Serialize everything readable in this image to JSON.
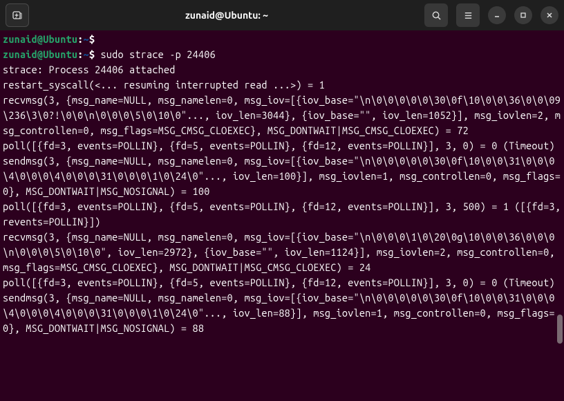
{
  "window": {
    "title": "zunaid@Ubuntu: ~"
  },
  "prompt": {
    "user_host": "zunaid@Ubuntu",
    "path": "~",
    "symbol": "$"
  },
  "commands": {
    "line1": "",
    "line2": "sudo strace -p 24406"
  },
  "output": [
    "strace: Process 24406 attached",
    "restart_syscall(<... resuming interrupted read ...>) = 1",
    "recvmsg(3, {msg_name=NULL, msg_namelen=0, msg_iov=[{iov_base=\"\\n\\0\\0\\0\\0\\0\\30\\0f\\10\\0\\0\\36\\0\\0\\09\\236\\3\\0?!\\0\\0\\n\\0\\0\\0\\5\\0\\10\\0\"..., iov_len=3044}, {iov_base=\"\", iov_len=1052}], msg_iovlen=2, msg_controllen=0, msg_flags=MSG_CMSG_CLOEXEC}, MSG_DONTWAIT|MSG_CMSG_CLOEXEC) = 72",
    "poll([{fd=3, events=POLLIN}, {fd=5, events=POLLIN}, {fd=12, events=POLLIN}], 3, 0) = 0 (Timeout)",
    "sendmsg(3, {msg_name=NULL, msg_namelen=0, msg_iov=[{iov_base=\"\\n\\0\\0\\0\\0\\0\\30\\0f\\10\\0\\0\\31\\0\\0\\0\\4\\0\\0\\0\\4\\0\\0\\0\\31\\0\\0\\0\\1\\0\\24\\0\"..., iov_len=100}], msg_iovlen=1, msg_controllen=0, msg_flags=0}, MSG_DONTWAIT|MSG_NOSIGNAL) = 100",
    "poll([{fd=3, events=POLLIN}, {fd=5, events=POLLIN}, {fd=12, events=POLLIN}], 3, 500) = 1 ([{fd=3, revents=POLLIN}])",
    "recvmsg(3, {msg_name=NULL, msg_namelen=0, msg_iov=[{iov_base=\"\\n\\0\\0\\0\\1\\0\\20\\0g\\10\\0\\0\\36\\0\\0\\0\\n\\0\\0\\0\\5\\0\\10\\0\", iov_len=2972}, {iov_base=\"\", iov_len=1124}], msg_iovlen=2, msg_controllen=0, msg_flags=MSG_CMSG_CLOEXEC}, MSG_DONTWAIT|MSG_CMSG_CLOEXEC) = 24",
    "poll([{fd=3, events=POLLIN}, {fd=5, events=POLLIN}, {fd=12, events=POLLIN}], 3, 0) = 0 (Timeout)",
    "sendmsg(3, {msg_name=NULL, msg_namelen=0, msg_iov=[{iov_base=\"\\n\\0\\0\\0\\0\\0\\30\\0f\\10\\0\\0\\31\\0\\0\\0\\4\\0\\0\\0\\4\\0\\0\\0\\31\\0\\0\\0\\1\\0\\24\\0\"..., iov_len=88}], msg_iovlen=1, msg_controllen=0, msg_flags=0}, MSG_DONTWAIT|MSG_NOSIGNAL) = 88"
  ]
}
